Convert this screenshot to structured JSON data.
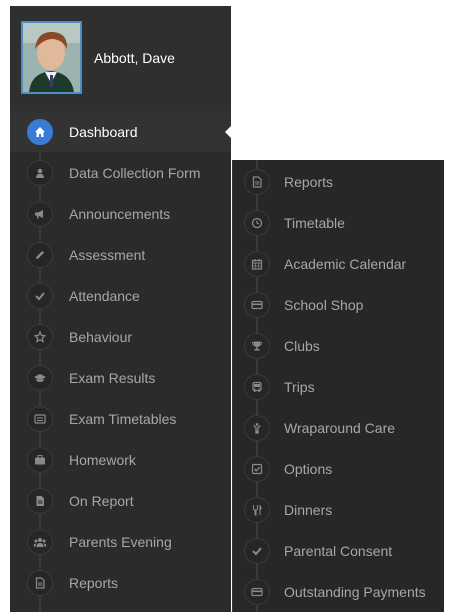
{
  "profile": {
    "name": "Abbott, Dave"
  },
  "sidebar": {
    "items": [
      {
        "label": "Dashboard",
        "icon": "home-icon",
        "active": true
      },
      {
        "label": "Data Collection Form",
        "icon": "user-icon"
      },
      {
        "label": "Announcements",
        "icon": "megaphone-icon"
      },
      {
        "label": "Assessment",
        "icon": "pencil-icon"
      },
      {
        "label": "Attendance",
        "icon": "check-icon"
      },
      {
        "label": "Behaviour",
        "icon": "star-icon"
      },
      {
        "label": "Exam Results",
        "icon": "graduation-cap-icon"
      },
      {
        "label": "Exam Timetables",
        "icon": "list-icon"
      },
      {
        "label": "Homework",
        "icon": "briefcase-icon"
      },
      {
        "label": "On Report",
        "icon": "document-icon"
      },
      {
        "label": "Parents Evening",
        "icon": "group-icon"
      },
      {
        "label": "Reports",
        "icon": "file-icon"
      }
    ]
  },
  "submenu": {
    "items": [
      {
        "label": "Reports",
        "icon": "file-icon"
      },
      {
        "label": "Timetable",
        "icon": "clock-icon"
      },
      {
        "label": "Academic Calendar",
        "icon": "calendar-icon"
      },
      {
        "label": "School Shop",
        "icon": "credit-card-icon"
      },
      {
        "label": "Clubs",
        "icon": "trophy-icon"
      },
      {
        "label": "Trips",
        "icon": "bus-icon"
      },
      {
        "label": "Wraparound Care",
        "icon": "child-icon"
      },
      {
        "label": "Options",
        "icon": "checkbox-icon"
      },
      {
        "label": "Dinners",
        "icon": "cutlery-icon"
      },
      {
        "label": "Parental Consent",
        "icon": "check-icon"
      },
      {
        "label": "Outstanding Payments",
        "icon": "credit-card-icon"
      }
    ]
  },
  "colors": {
    "sidebar_bg": "#2b2b2b",
    "accent": "#3a7bd5",
    "text_muted": "#a7a7a7",
    "text_active": "#ffffff"
  }
}
